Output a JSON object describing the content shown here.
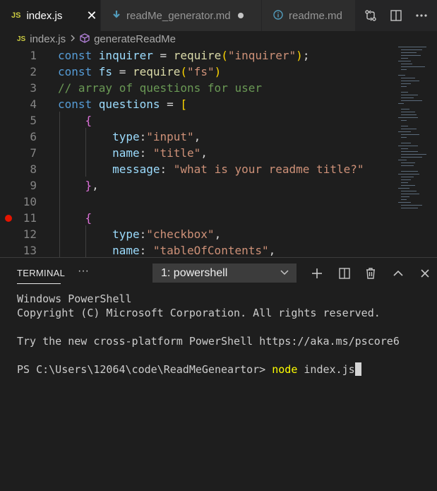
{
  "tabs": [
    {
      "badge": "JS",
      "name": "index.js",
      "close": "✕",
      "active": true
    },
    {
      "name": "readMe_generator.md",
      "modified": true
    },
    {
      "name": "readme.md"
    }
  ],
  "breadcrumb": {
    "badge": "JS",
    "file": "index.js",
    "symbol": "generateReadMe"
  },
  "editor": {
    "line_numbers": [
      "1",
      "2",
      "3",
      "4",
      "5",
      "6",
      "7",
      "8",
      "9",
      "10",
      "11",
      "12",
      "13"
    ],
    "breakpoint_line": "11",
    "lines": [
      [
        {
          "t": "const ",
          "c": "kw"
        },
        {
          "t": "inquirer",
          "c": "var"
        },
        {
          "t": " = ",
          "c": ""
        },
        {
          "t": "require",
          "c": "fn"
        },
        {
          "t": "(",
          "c": "br1"
        },
        {
          "t": "\"inquirer\"",
          "c": "str"
        },
        {
          "t": ")",
          "c": "br1"
        },
        {
          "t": ";",
          "c": ""
        }
      ],
      [
        {
          "t": "const ",
          "c": "kw"
        },
        {
          "t": "fs",
          "c": "var"
        },
        {
          "t": " = ",
          "c": ""
        },
        {
          "t": "require",
          "c": "fn"
        },
        {
          "t": "(",
          "c": "br1"
        },
        {
          "t": "\"fs\"",
          "c": "str"
        },
        {
          "t": ")",
          "c": "br1"
        }
      ],
      [
        {
          "t": "// array of questions for user",
          "c": "cmt"
        }
      ],
      [
        {
          "t": "const ",
          "c": "kw"
        },
        {
          "t": "questions",
          "c": "var"
        },
        {
          "t": " = ",
          "c": ""
        },
        {
          "t": "[",
          "c": "br1"
        }
      ],
      [
        {
          "t": "    ",
          "c": ""
        },
        {
          "t": "{",
          "c": "br2"
        }
      ],
      [
        {
          "t": "        ",
          "c": ""
        },
        {
          "t": "type",
          "c": "var"
        },
        {
          "t": ":",
          "c": ""
        },
        {
          "t": "\"input\"",
          "c": "str"
        },
        {
          "t": ",",
          "c": ""
        }
      ],
      [
        {
          "t": "        ",
          "c": ""
        },
        {
          "t": "name",
          "c": "var"
        },
        {
          "t": ": ",
          "c": ""
        },
        {
          "t": "\"title\"",
          "c": "str"
        },
        {
          "t": ",",
          "c": ""
        }
      ],
      [
        {
          "t": "        ",
          "c": ""
        },
        {
          "t": "message",
          "c": "var"
        },
        {
          "t": ": ",
          "c": ""
        },
        {
          "t": "\"what is your readme title?\"",
          "c": "str"
        }
      ],
      [
        {
          "t": "    ",
          "c": ""
        },
        {
          "t": "}",
          "c": "br2"
        },
        {
          "t": ",",
          "c": ""
        }
      ],
      [],
      [
        {
          "t": "    ",
          "c": ""
        },
        {
          "t": "{",
          "c": "br2"
        }
      ],
      [
        {
          "t": "        ",
          "c": ""
        },
        {
          "t": "type",
          "c": "var"
        },
        {
          "t": ":",
          "c": ""
        },
        {
          "t": "\"checkbox\"",
          "c": "str"
        },
        {
          "t": ",",
          "c": ""
        }
      ],
      [
        {
          "t": "        ",
          "c": ""
        },
        {
          "t": "name",
          "c": "var"
        },
        {
          "t": ": ",
          "c": ""
        },
        {
          "t": "\"tableOfContents\"",
          "c": "str"
        },
        {
          "t": ",",
          "c": ""
        }
      ]
    ]
  },
  "panel": {
    "tab_label": "TERMINAL",
    "more_label": "···",
    "terminal_select": "1: powershell"
  },
  "terminal": {
    "lines": [
      "Windows PowerShell",
      "Copyright (C) Microsoft Corporation. All rights reserved.",
      "",
      "Try the new cross-platform PowerShell https://aka.ms/pscore6",
      ""
    ],
    "prompt": "PS C:\\Users\\12064\\code\\ReadMeGeneartor> ",
    "command": "node",
    "args": " index.js"
  },
  "colors": {
    "editor_bg": "#1e1e1e",
    "keyword": "#569cd6",
    "string": "#ce9178",
    "comment": "#6a9955",
    "breakpoint": "#e51400"
  },
  "icons": {
    "md_file": "download-arrow-icon",
    "readme_file": "info-icon",
    "compare": "git-compare-icon",
    "split": "split-editor-icon",
    "more": "more-icon",
    "symbol": "cube-icon",
    "new_terminal": "plus-icon",
    "split_terminal": "split-icon",
    "kill_terminal": "trash-icon",
    "maximize": "chevron-up-icon",
    "close_panel": "close-icon"
  }
}
